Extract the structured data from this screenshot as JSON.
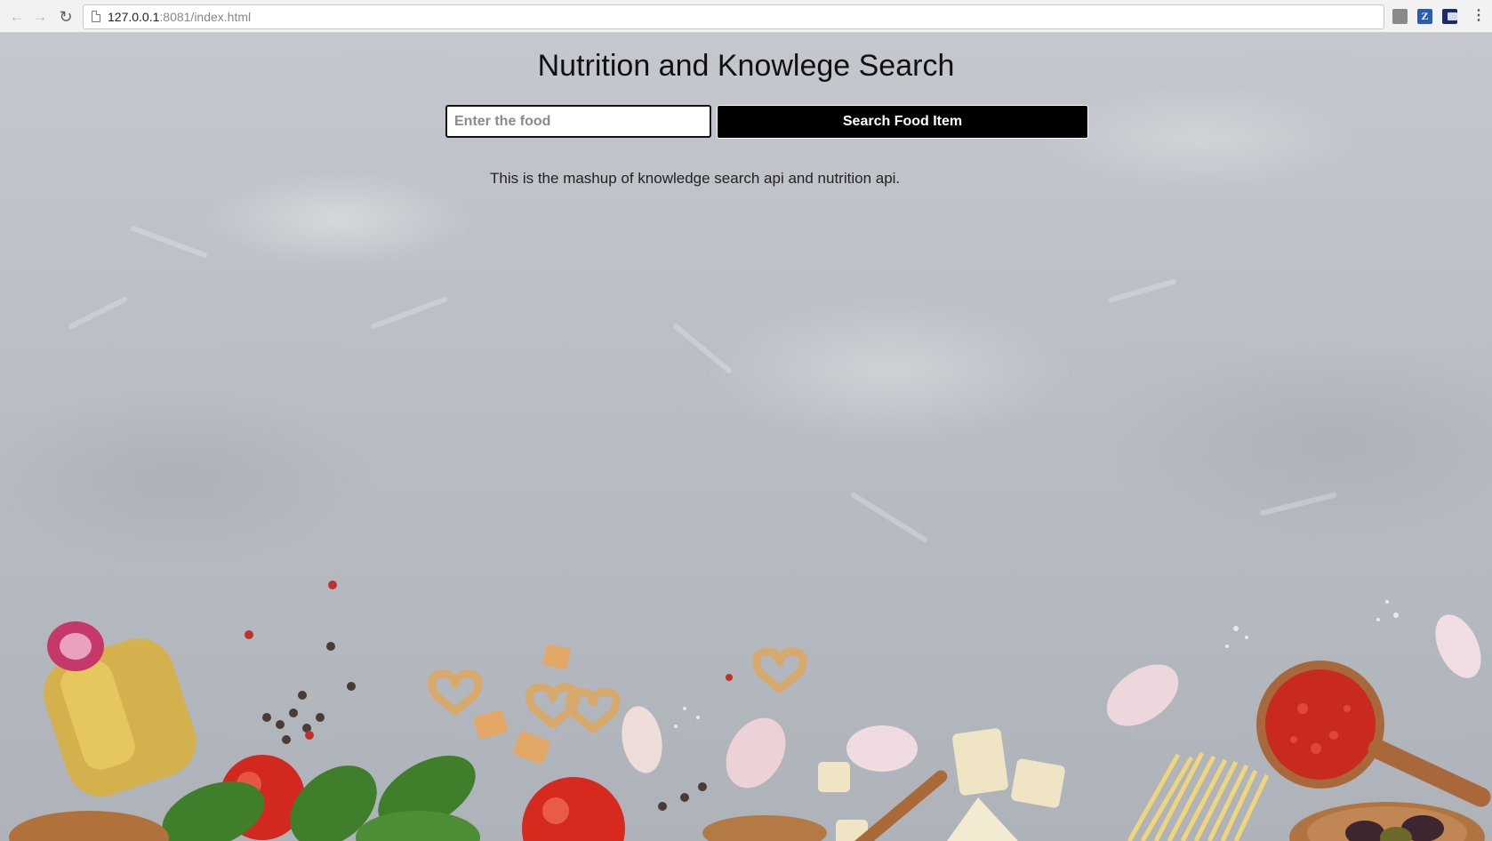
{
  "browser": {
    "url_host": "127.0.0.1",
    "url_path": ":8081/index.html",
    "back_icon": "arrow-left",
    "forward_icon": "arrow-right",
    "reload_icon": "reload",
    "extensions": [
      {
        "name": "shield-extension-icon",
        "label": ""
      },
      {
        "name": "zotero-extension-icon",
        "label": "Z"
      },
      {
        "name": "image-extension-icon",
        "label": ""
      }
    ],
    "menu_icon": "vertical-dots"
  },
  "page": {
    "title": "Nutrition and Knowlege Search",
    "search": {
      "placeholder": "Enter the food",
      "value": ""
    },
    "button_label": "Search Food Item",
    "description": "This is the mashup of knowledge search api and nutrition api.",
    "background": "grey concrete texture with food ingredients along the bottom"
  },
  "colors": {
    "button_bg": "#000000",
    "button_text": "#ffffff",
    "text": "#111111"
  }
}
